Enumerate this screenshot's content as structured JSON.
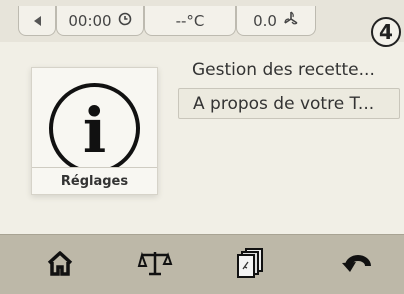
{
  "status_bar": {
    "time": "00:00",
    "temperature": "--°C",
    "fan_value": "0.0",
    "step_badge": "4"
  },
  "settings_tile": {
    "label": "Réglages",
    "icon": "info-icon"
  },
  "menu": {
    "items": [
      {
        "label": "Gestion des recette..."
      },
      {
        "label": "A propos de votre T..."
      }
    ],
    "selected_index": 1
  },
  "bottom_nav": {
    "icons": [
      "home-icon",
      "scale-icon",
      "recipe-book-icon",
      "return-icon"
    ]
  },
  "colors": {
    "background": "#f1efe6",
    "bottom_bar": "#bdb8a8",
    "text": "#333333"
  }
}
